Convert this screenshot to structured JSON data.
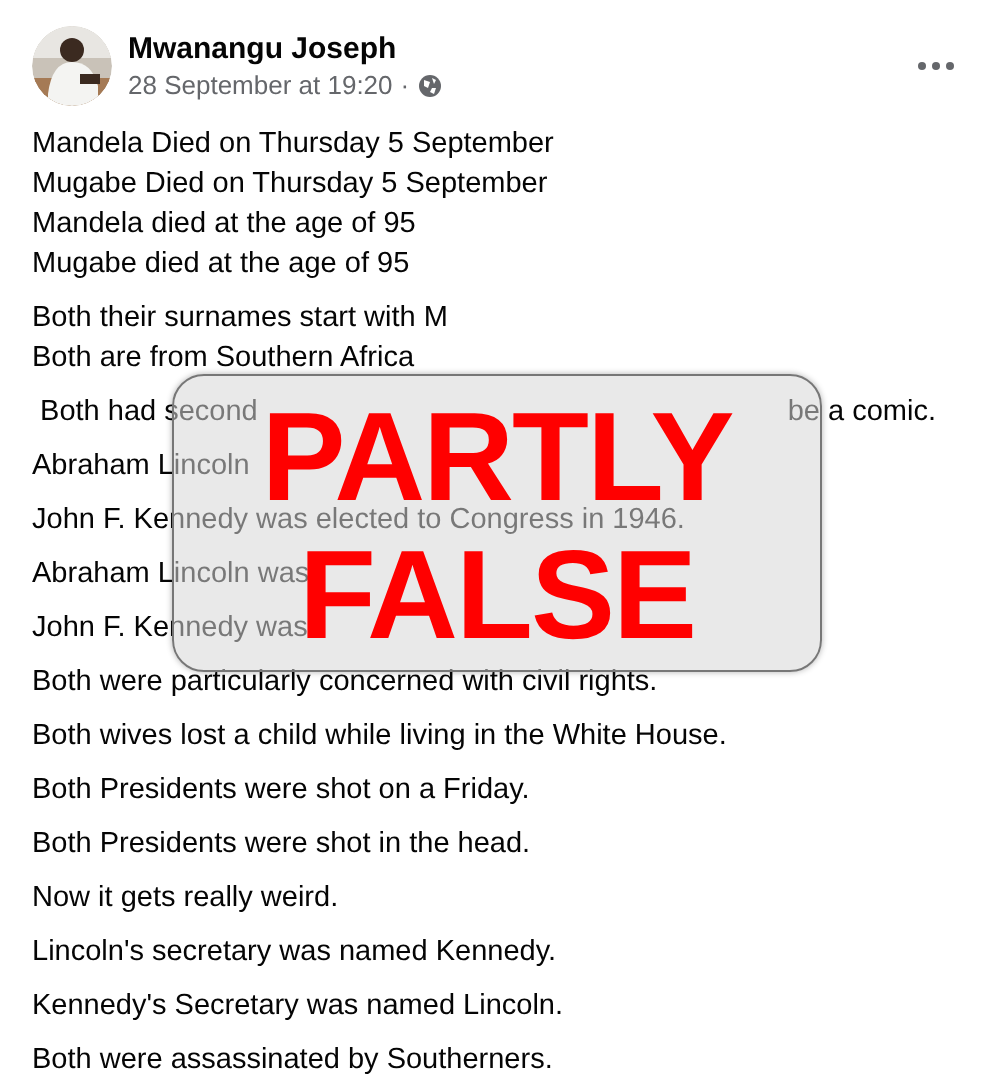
{
  "post": {
    "author": "Mwanangu Joseph",
    "time": "28 September at 19:20",
    "separator": "·",
    "paragraphs": [
      {
        "lines": [
          "Mandela Died on Thursday 5 September",
          "Mugabe Died on Thursday 5 September",
          "Mandela died at the age of 95",
          "Mugabe died at the age of 95"
        ]
      },
      {
        "lines": [
          "Both their surnames start with M",
          "Both are from Southern Africa"
        ]
      },
      {
        "lines": [
          [
            " Both had second",
            "be a comic."
          ]
        ]
      },
      {
        "lines": [
          "Abraham Lincoln"
        ]
      },
      {
        "lines": [
          "John F. Kennedy was elected to Congress in 1946."
        ]
      },
      {
        "lines": [
          "Abraham Lincoln was"
        ]
      },
      {
        "lines": [
          "John F. Kennedy was"
        ]
      },
      {
        "lines": [
          "Both were particularly concerned with civil rights."
        ]
      },
      {
        "lines": [
          "Both wives lost a child while living in the White House."
        ]
      },
      {
        "lines": [
          "Both Presidents were shot on a Friday."
        ]
      },
      {
        "lines": [
          "Both Presidents were shot in the head."
        ]
      },
      {
        "lines": [
          "Now it gets really weird."
        ]
      },
      {
        "lines": [
          "Lincoln's secretary was named Kennedy."
        ]
      },
      {
        "lines": [
          "Kennedy's Secretary was named Lincoln."
        ]
      },
      {
        "lines": [
          "Both were assassinated by Southerners."
        ]
      }
    ]
  },
  "stamp": {
    "lines": [
      "PARTLY",
      "FALSE"
    ]
  }
}
